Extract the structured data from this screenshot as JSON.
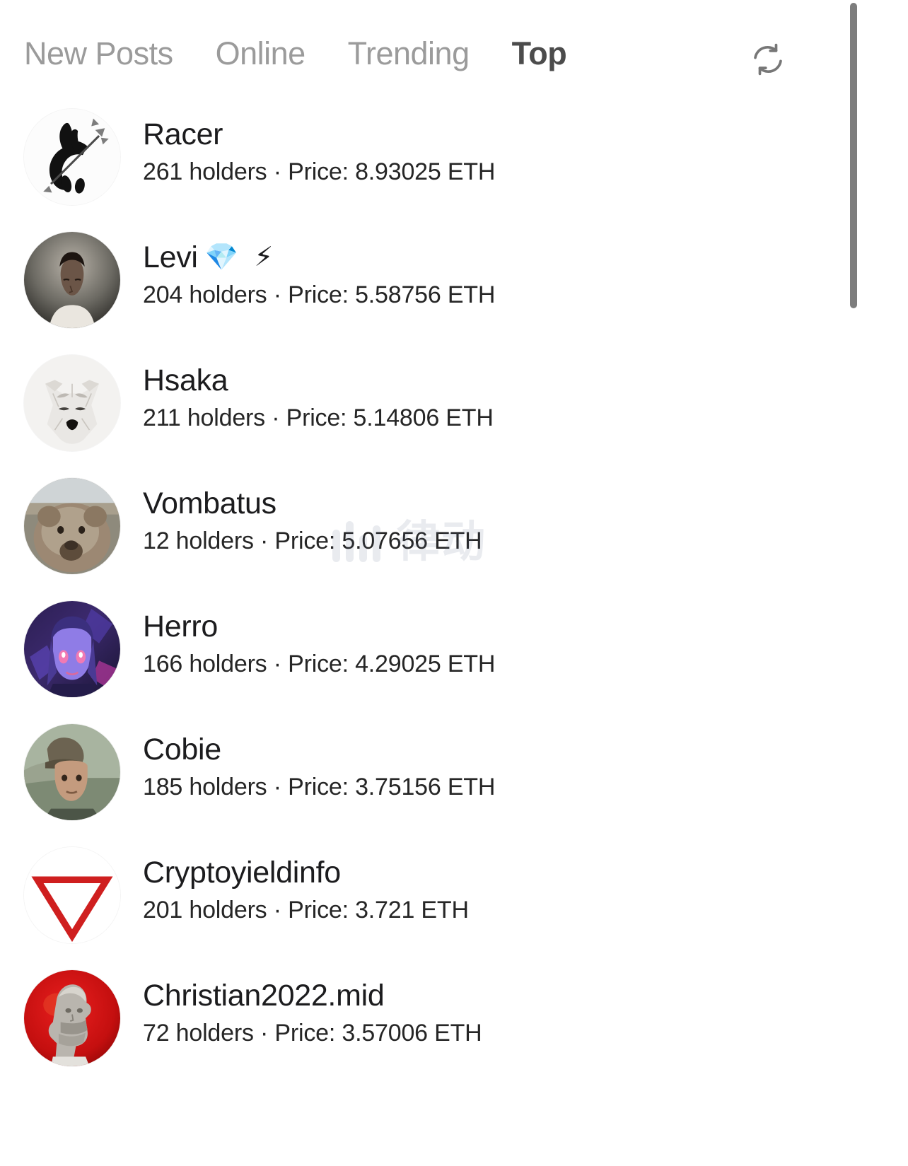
{
  "header": {
    "tabs": [
      {
        "label": "New Posts",
        "active": false
      },
      {
        "label": "Online",
        "active": false
      },
      {
        "label": "Trending",
        "active": false
      },
      {
        "label": "Top",
        "active": true
      }
    ],
    "refresh_icon": "refresh-icon"
  },
  "watermark": {
    "text": "律动",
    "icon": "bars-logo-icon"
  },
  "colors": {
    "tab_active": "#4c4c4c",
    "tab_inactive": "#9b9b9b",
    "name_text": "#1c1c1e",
    "meta_text": "#262626",
    "scrollbar": "#7d7d7d",
    "background": "#ffffff"
  },
  "list": {
    "items": [
      {
        "name": "Racer",
        "emoji": "",
        "holders": "261 holders",
        "separator": "·",
        "price": "Price: 8.93025 ETH",
        "avatar": "black-rabbit-arrow-avatar"
      },
      {
        "name": "Levi",
        "emoji": "💎 ⚡",
        "holders": "204 holders",
        "separator": "·",
        "price": "Price: 5.58756 ETH",
        "avatar": "man-portrait-avatar"
      },
      {
        "name": "Hsaka",
        "emoji": "",
        "holders": "211 holders",
        "separator": "·",
        "price": "Price: 5.14806 ETH",
        "avatar": "white-wolf-mask-avatar"
      },
      {
        "name": "Vombatus",
        "emoji": "",
        "holders": "12 holders",
        "separator": "·",
        "price": "Price: 5.07656 ETH",
        "avatar": "wombat-photo-avatar"
      },
      {
        "name": "Herro",
        "emoji": "",
        "holders": "166 holders",
        "separator": "·",
        "price": "Price: 4.29025 ETH",
        "avatar": "anime-girl-avatar"
      },
      {
        "name": "Cobie",
        "emoji": "",
        "holders": "185 holders",
        "separator": "·",
        "price": "Price: 3.75156 ETH",
        "avatar": "man-cap-photo-avatar"
      },
      {
        "name": "Cryptoyieldinfo",
        "emoji": "",
        "holders": "201 holders",
        "separator": "·",
        "price": "Price: 3.721 ETH",
        "avatar": "red-triangle-avatar"
      },
      {
        "name": "Christian2022.mid",
        "emoji": "",
        "holders": "72 holders",
        "separator": "·",
        "price": "Price: 3.57006 ETH",
        "avatar": "red-statue-bust-avatar"
      }
    ]
  }
}
